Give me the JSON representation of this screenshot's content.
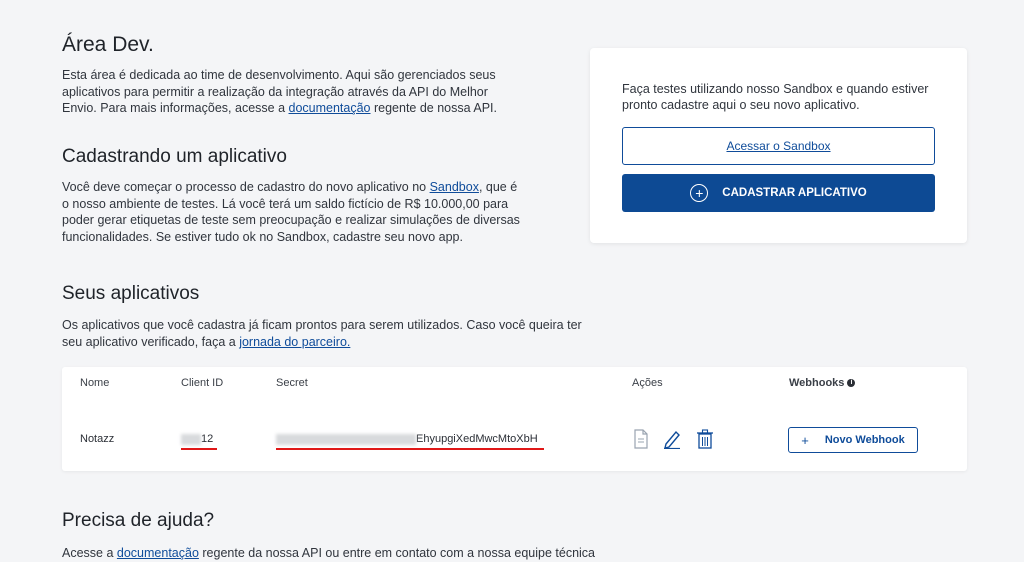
{
  "dev": {
    "title": "Área Dev.",
    "text_before": "Esta área é dedicada ao time de desenvolvimento. Aqui são gerenciados seus aplicativos para permitir a realização da integração através da API do Melhor Envio. Para mais informações, acesse a ",
    "link": "documentação",
    "text_after": " regente de nossa API."
  },
  "cadastro": {
    "title": "Cadastrando um aplicativo",
    "text_before": "Você deve começar o processo de cadastro do novo aplicativo no ",
    "link": "Sandbox",
    "text_after": ", que é o nosso ambiente de testes. Lá você terá um saldo fictício de R$ 10.000,00 para poder gerar etiquetas de teste sem preocupação e realizar simulações de diversas funcionalidades. Se estiver tudo ok no Sandbox, cadastre seu novo app."
  },
  "sandbox_card": {
    "text": "Faça testes utilizando nosso Sandbox e quando estiver pronto cadastre aqui o seu novo aplicativo.",
    "sandbox_button": "Acessar o Sandbox",
    "register_button": "CADASTRAR APLICATIVO"
  },
  "apps": {
    "title": "Seus aplicativos",
    "text_before": "Os aplicativos que você cadastra já ficam prontos para serem utilizados. Caso você queira ter seu aplicativo verificado, faça a ",
    "link": "jornada do parceiro.",
    "columns": {
      "name": "Nome",
      "client_id": "Client ID",
      "secret": "Secret",
      "actions": "Ações",
      "webhooks": "Webhooks"
    },
    "rows": [
      {
        "name": "Notazz",
        "client_id_suffix": "12",
        "secret_suffix": "EhyupgiXedMwcMtoXbH",
        "webhook_button": "Novo Webhook"
      }
    ]
  },
  "help": {
    "title": "Precisa de ajuda?",
    "text_before": "Acesse a ",
    "link": "documentação",
    "text_after": " regente da nossa API ou entre em contato com a nossa equipe técnica"
  },
  "colors": {
    "primary": "#0d4a94",
    "background": "#f4f5f7",
    "highlight": "#e01818"
  }
}
